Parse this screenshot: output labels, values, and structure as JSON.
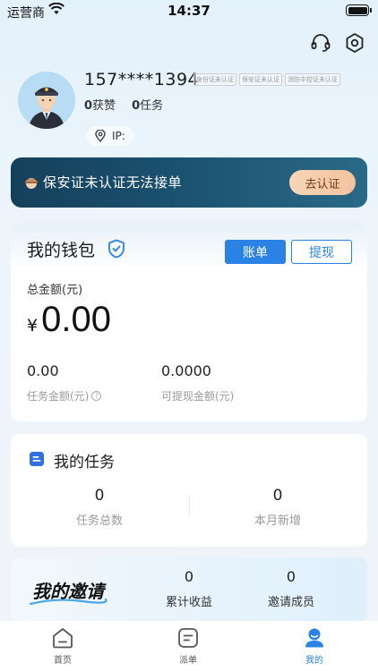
{
  "status_bar": {
    "carrier": "运营商",
    "time": "14:37"
  },
  "profile": {
    "phone": "157****1394",
    "tags": [
      "身份证未认证",
      "保安证未认证",
      "消防中控证未认证"
    ],
    "likes_count": "0",
    "likes_label": "获赞",
    "tasks_count": "0",
    "tasks_label": "任务",
    "ip_label": "IP:"
  },
  "banner": {
    "text": "保安证未认证无法接单",
    "button": "去认证"
  },
  "wallet": {
    "title": "我的钱包",
    "bill_button": "账单",
    "withdraw_button": "提现",
    "total_label": "总金额(元)",
    "currency": "¥",
    "total_amount": "0.00",
    "task_amount": "0.00",
    "task_amount_label": "任务金额(元)",
    "withdrawable_amount": "0.0000",
    "withdrawable_label": "可提现金额(元)"
  },
  "tasks": {
    "title": "我的任务",
    "total": "0",
    "total_label": "任务总数",
    "month_new": "0",
    "month_new_label": "本月新增"
  },
  "invite": {
    "title": "我的邀请",
    "earnings": "0",
    "earnings_label": "累计收益",
    "members": "0",
    "members_label": "邀请成员"
  },
  "tabbar": {
    "items": [
      {
        "label": "首页",
        "icon": "home-icon"
      },
      {
        "label": "派单",
        "icon": "dispatch-icon"
      },
      {
        "label": "我的",
        "icon": "profile-icon"
      }
    ],
    "active_index": 2
  },
  "colors": {
    "accent": "#2a82e4",
    "banner": "#1b5371",
    "banner_button": "#f3c39d"
  }
}
